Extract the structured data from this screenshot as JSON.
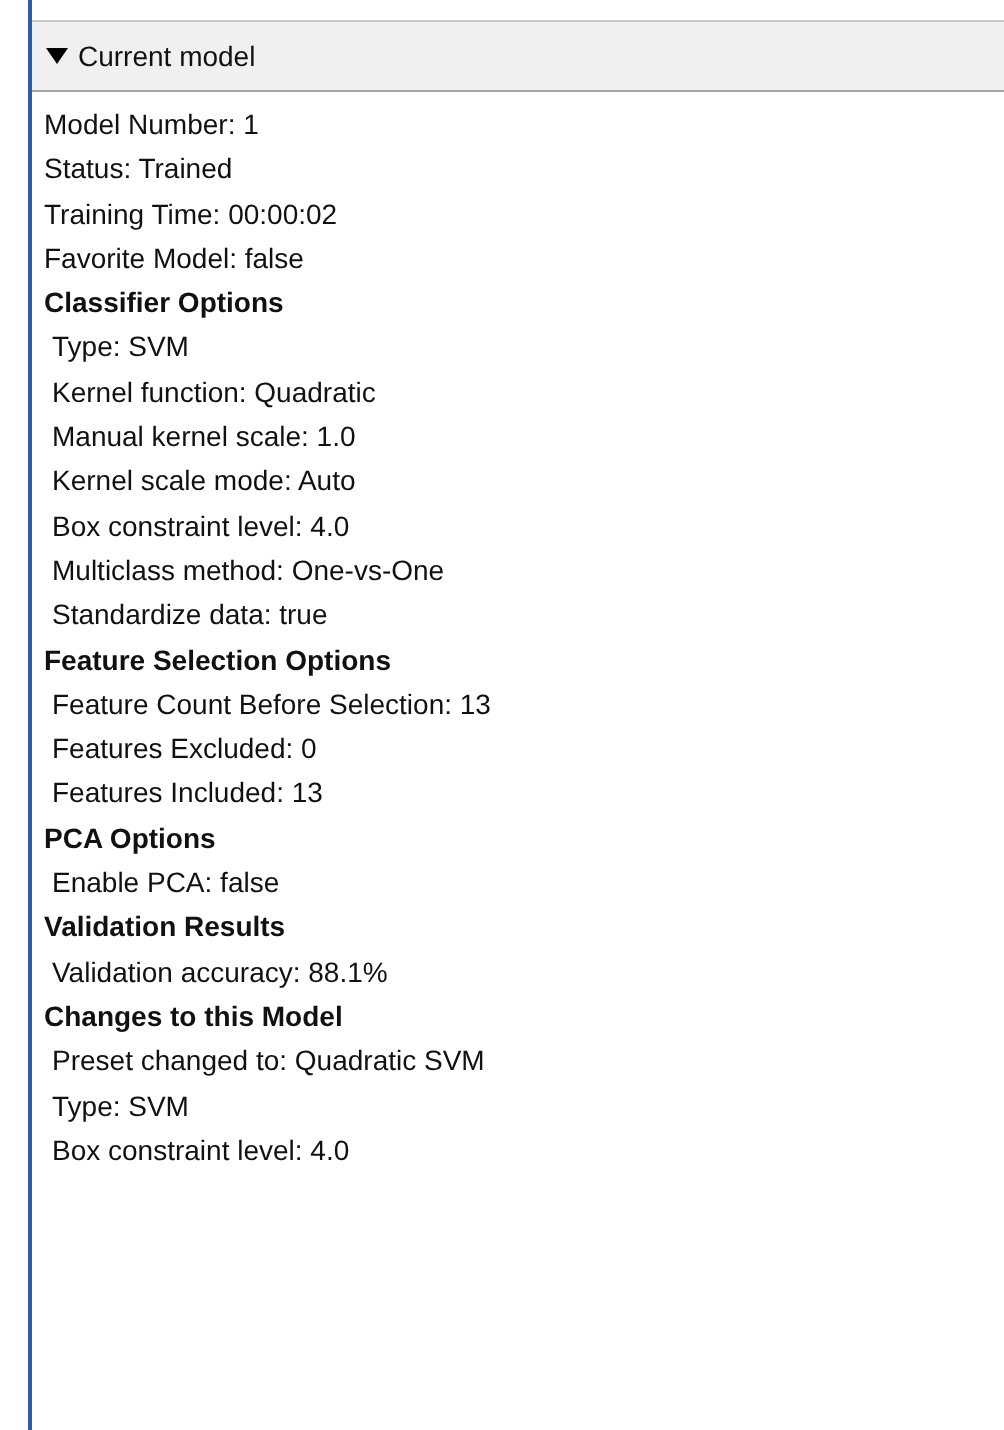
{
  "panel": {
    "title": "Current model",
    "expanded": true
  },
  "summary": [
    "Model Number: 1",
    "Status: Trained",
    "Training Time: 00:00:02",
    "Favorite Model: false"
  ],
  "sections": [
    {
      "title": "Classifier Options",
      "items": [
        "Type: SVM",
        "Kernel function: Quadratic",
        "Manual kernel scale: 1.0",
        "Kernel scale mode: Auto",
        "Box constraint level: 4.0",
        "Multiclass method: One-vs-One",
        "Standardize data: true"
      ]
    },
    {
      "title": "Feature Selection Options",
      "items": [
        "Feature Count Before Selection: 13",
        "Features Excluded: 0",
        "Features Included: 13"
      ]
    },
    {
      "title": "PCA Options",
      "items": [
        "Enable PCA: false"
      ]
    },
    {
      "title": "Validation Results",
      "items": [
        "Validation accuracy: 88.1%"
      ]
    },
    {
      "title": "Changes to this Model",
      "items": [
        "Preset changed to: Quadratic SVM",
        "Type: SVM",
        "Box constraint level: 4.0"
      ]
    }
  ]
}
